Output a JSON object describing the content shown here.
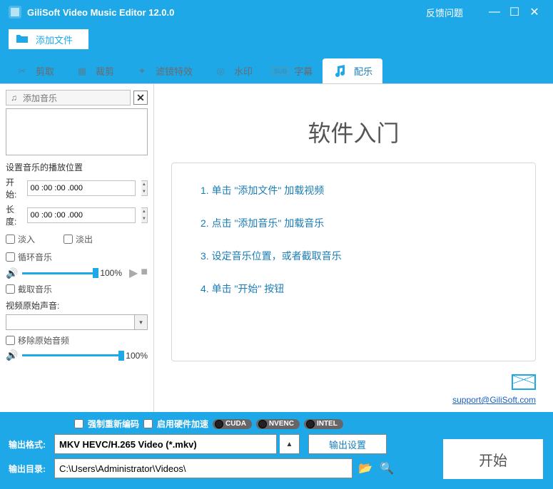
{
  "titlebar": {
    "title": "GiliSoft Video Music Editor 12.0.0",
    "feedback": "反馈问题"
  },
  "toolbar": {
    "add_file": "添加文件"
  },
  "tabs": {
    "cut": "剪取",
    "crop": "裁剪",
    "effect": "滤镜特效",
    "watermark": "水印",
    "subtitle": "字幕",
    "music": "配乐"
  },
  "sidebar": {
    "add_music": "添加音乐",
    "position_label": "设置音乐的播放位置",
    "start_label": "开始:",
    "length_label": "长度:",
    "time_zero": "00 :00 :00 .000",
    "fade_in": "淡入",
    "fade_out": "淡出",
    "loop": "循环音乐",
    "volume_pct": "100%",
    "intercept": "截取音乐",
    "original_audio_label": "视频原始声音:",
    "remove_original": "移除原始音频"
  },
  "guide": {
    "title": "软件入门",
    "step1": "1. 单击 \"添加文件\" 加载视频",
    "step2": "2. 点击 \"添加音乐\" 加载音乐",
    "step3": "3. 设定音乐位置，或者截取音乐",
    "step4": "4. 单击 \"开始\" 按钮",
    "support_email": "support@GiliSoft.com"
  },
  "bottom": {
    "force_reencode": "强制重新编码",
    "hw_accel": "启用硬件加速",
    "hw1": "CUDA",
    "hw2": "NVENC",
    "hw3": "INTEL",
    "format_label": "输出格式:",
    "format_value": "MKV HEVC/H.265 Video (*.mkv)",
    "settings_btn": "输出设置",
    "dir_label": "输出目录:",
    "dir_value": "C:\\Users\\Administrator\\Videos\\",
    "start_btn": "开始"
  }
}
